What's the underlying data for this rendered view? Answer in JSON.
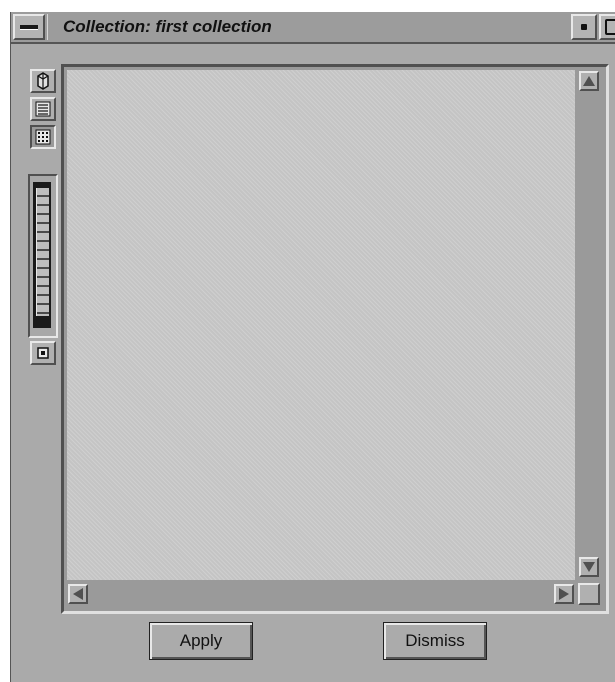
{
  "window": {
    "title": "Collection: first collection"
  },
  "toolbar": {
    "tools": [
      {
        "name": "icon-view-icon"
      },
      {
        "name": "list-view-icon"
      },
      {
        "name": "column-view-icon"
      }
    ],
    "zoom_slider_level": 0.92
  },
  "buttons": {
    "apply_label": "Apply",
    "dismiss_label": "Dismiss"
  }
}
